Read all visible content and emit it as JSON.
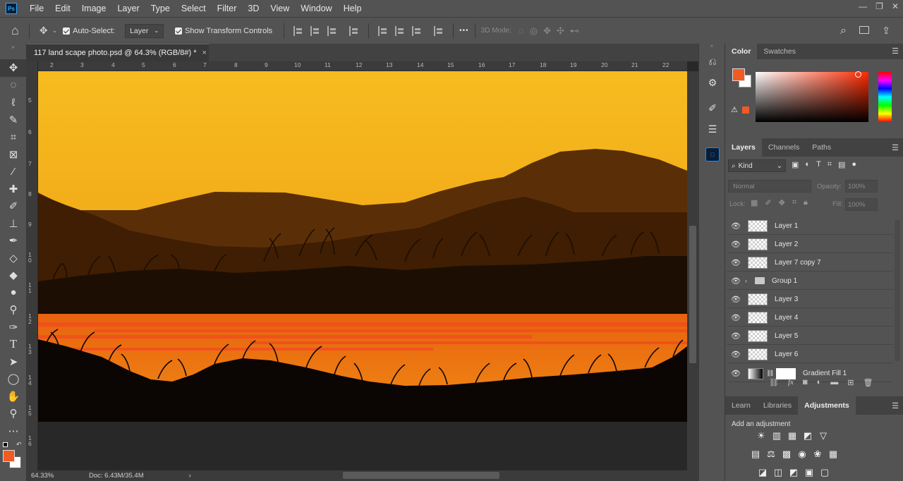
{
  "app": {
    "logo": "Ps"
  },
  "menu": [
    "File",
    "Edit",
    "Image",
    "Layer",
    "Type",
    "Select",
    "Filter",
    "3D",
    "View",
    "Window",
    "Help"
  ],
  "window_controls": [
    "—",
    "❐",
    "✕"
  ],
  "options": {
    "auto_select_label": "Auto-Select:",
    "auto_select_value": "Layer",
    "show_transform_label": "Show Transform Controls",
    "mode_3d_label": "3D Mode:",
    "more_label": "•••"
  },
  "document": {
    "tab_title": "117 land scape photo.psd @ 64.3% (RGB/8#) *",
    "close": "×"
  },
  "ruler": {
    "top": [
      "2",
      "3",
      "4",
      "5",
      "6",
      "7",
      "8",
      "9",
      "10",
      "11",
      "12",
      "13",
      "14",
      "15",
      "16",
      "17",
      "18",
      "19",
      "20",
      "21",
      "22"
    ],
    "left": [
      "5",
      "6",
      "7",
      "8",
      "9",
      "1\n0",
      "1\n1",
      "1\n2",
      "1\n3",
      "1\n4",
      "1\n5",
      "1\n6"
    ]
  },
  "status": {
    "zoom": "64.33%",
    "doc": "Doc: 6.43M/35.4M",
    "arrow": "›"
  },
  "color_panel": {
    "tabs": [
      "Color",
      "Swatches"
    ],
    "fg": "#f15a22",
    "bg": "#ffffff",
    "hue": "#ff2a00"
  },
  "layers_panel": {
    "tabs": [
      "Layers",
      "Channels",
      "Paths"
    ],
    "filter_kind": "Kind",
    "blend_mode": "Normal",
    "opacity_label": "Opacity:",
    "opacity_value": "100%",
    "lock_label": "Lock:",
    "fill_label": "Fill:",
    "fill_value": "100%",
    "layers": [
      {
        "name": "Layer 1"
      },
      {
        "name": "Layer 2"
      },
      {
        "name": "Layer 7 copy 7"
      },
      {
        "name": "Group 1"
      },
      {
        "name": "Layer 3"
      },
      {
        "name": "Layer 4"
      },
      {
        "name": "Layer 5"
      },
      {
        "name": "Layer 6"
      },
      {
        "name": "Gradient Fill 1"
      }
    ],
    "footer_icons": [
      "link-icon",
      "fx-icon",
      "mask-icon",
      "adjustment-icon",
      "folder-icon",
      "new-layer-icon",
      "trash-icon"
    ]
  },
  "adjustments_panel": {
    "tabs": [
      "Learn",
      "Libraries",
      "Adjustments"
    ],
    "hint": "Add an adjustment",
    "row1": [
      "☀",
      "▥",
      "▦",
      "◩",
      "▽"
    ],
    "row2": [
      "▤",
      "⚖",
      "▩",
      "◉",
      "❀",
      "▦"
    ],
    "row3": [
      "◪",
      "◫",
      "◩",
      "▣",
      "▢"
    ]
  },
  "icons": {
    "home": "⌂",
    "move": "✥",
    "search": "⌕",
    "share": "⇪"
  }
}
